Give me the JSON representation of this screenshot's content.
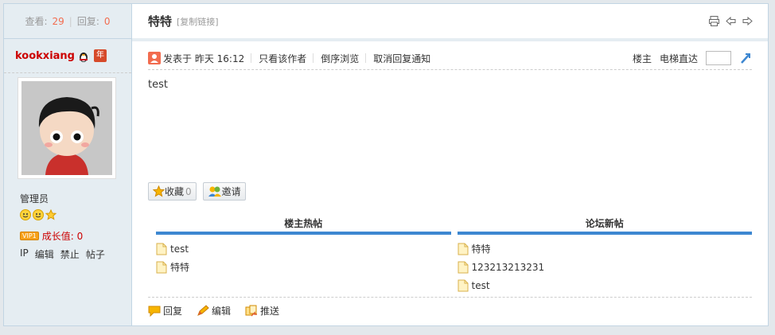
{
  "sidebar": {
    "views_label": "查看:",
    "views": "29",
    "replies_label": "回复:",
    "replies": "0",
    "username": "kookxiang",
    "year_badge": "年",
    "role": "管理员",
    "growth_badge": "VIP1",
    "growth_label": "成长值: 0",
    "admin_links": [
      "IP",
      "编辑",
      "禁止",
      "帖子"
    ]
  },
  "thread": {
    "title": "特特",
    "copy_link": "[复制链接]"
  },
  "meta": {
    "posted_label": "发表于 昨天 16:12",
    "only_author": "只看该作者",
    "reverse": "倒序浏览",
    "cancel_notify": "取消回复通知",
    "floor": "楼主",
    "elevator": "电梯直达"
  },
  "post": {
    "content": "test"
  },
  "buttons": {
    "favorite": "收藏",
    "favorite_count": "0",
    "invite": "邀请"
  },
  "hot_posts": {
    "heading": "楼主热帖",
    "items": [
      "test",
      "特特"
    ]
  },
  "new_posts": {
    "heading": "论坛新帖",
    "items": [
      "特特",
      "123213213231",
      "test"
    ]
  },
  "actions": {
    "reply": "回复",
    "edit": "编辑",
    "push": "推送"
  },
  "colors": {
    "accent_blue": "#3d87d1",
    "username_red": "#c00",
    "count_orange": "#f26c4f"
  }
}
